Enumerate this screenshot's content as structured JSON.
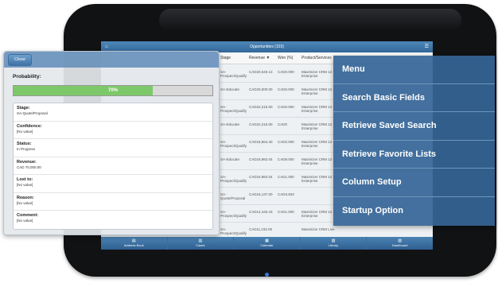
{
  "app": {
    "title": "Opportunities (103)",
    "home_icon": "home-icon",
    "settings_icon": "gear-icon"
  },
  "table": {
    "columns": [
      "Stage",
      "Revenue",
      "Won (%)",
      "Product/Services"
    ],
    "sort_indicator": "▼",
    "rows": [
      [
        "SA-Prospect/Qualify",
        "CAD20,540.13",
        "CAD0.000",
        "Maximizer CRM 12 - Enterprise"
      ],
      [
        "SA-Educate",
        "CAD20,000.00",
        "CAD0.000",
        "Maximizer CRM 12 - Enterprise"
      ],
      [
        "SA-Prospect/Qualify",
        "CAD22,215.00",
        "CAD0.000",
        "Maximizer CRM 12 - Enterprise"
      ],
      [
        "SA-Educate",
        "CAD22,215.00",
        "CAD0",
        "Maximizer CRM 12 - Enterprise"
      ],
      [
        "SA-Prospect/Qualify",
        "CAD18,964.40",
        "CAD2.000",
        "Maximizer CRM 12 - Enterprise"
      ],
      [
        "SA-Educate",
        "CAD18,982.04",
        "CAD8.000",
        "Maximizer CRM 12 - Enterprise"
      ],
      [
        "SA-Prospect/Qualify",
        "CAD16,982.04",
        "CAD1.000",
        "Maximizer CRM 12 - Enterprise"
      ],
      [
        "SA-Quote/Proposal",
        "CAD16,137.00",
        "CAD3.603",
        ""
      ],
      [
        "SA-Prospect/Qualify",
        "CAD14,440.43",
        "CAD1.000",
        "Maximizer CRM 12 - Enterprise"
      ],
      [
        "SA-Prospect/Qualify",
        "CAD11,232.00",
        "",
        "Maximizer CRM Live"
      ],
      [
        "SA-Prospect/Qualify",
        "CAD10,000.00",
        "CAD1.000",
        "Maximizer CRM Live"
      ]
    ]
  },
  "bottom_nav": [
    {
      "label": "Address Book",
      "icon": "book-icon"
    },
    {
      "label": "Cases",
      "icon": "case-icon"
    },
    {
      "label": "Calendar",
      "icon": "calendar-icon"
    },
    {
      "label": "Library",
      "icon": "library-icon"
    },
    {
      "label": "Dashboard",
      "icon": "dashboard-icon"
    }
  ],
  "panel": {
    "close_label": "Close",
    "probability_label": "Probability:",
    "probability_value": 0.7,
    "probability_text": "70%",
    "fields": [
      {
        "label": "Stage:",
        "value": "SA-Quote/Proposal"
      },
      {
        "label": "Confidence:",
        "value": "[No value]"
      },
      {
        "label": "Status:",
        "value": "In Progress"
      },
      {
        "label": "Revenue:",
        "value": "CAD 70,000.00"
      },
      {
        "label": "Lost to:",
        "value": "[No value]"
      },
      {
        "label": "Reason:",
        "value": "[No value]"
      },
      {
        "label": "Comment:",
        "value": "[No value]"
      }
    ]
  },
  "menu": {
    "items": [
      "Menu",
      "Search Basic Fields",
      "Retrieve Saved Search",
      "Retrieve Favorite Lists",
      "Column Setup",
      "Startup Option"
    ]
  },
  "colors": {
    "menu_bg": "#346596",
    "progress_fill": "#7dc96a",
    "header_blue": "#4d87b8"
  }
}
